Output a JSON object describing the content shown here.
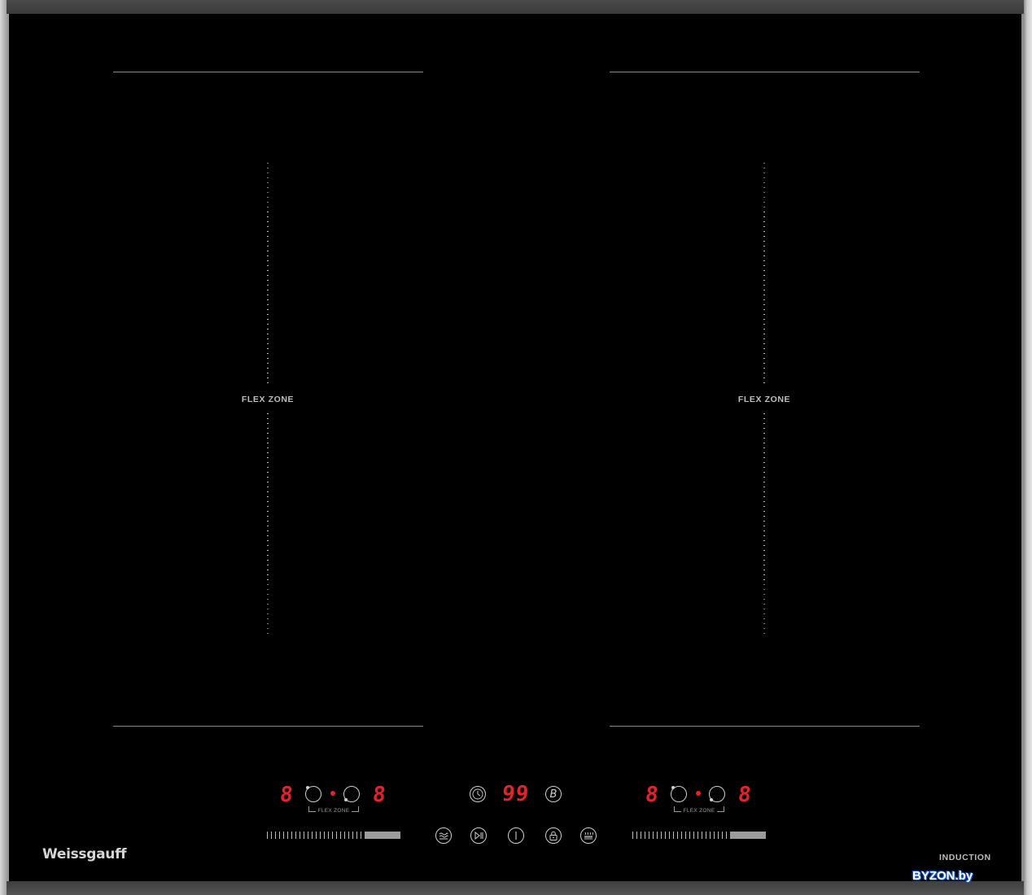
{
  "zones": {
    "left": {
      "label": "FLEX ZONE",
      "display_left": "8",
      "display_right": "8",
      "link_label": "FLEX ZONE"
    },
    "right": {
      "label": "FLEX ZONE",
      "display_left": "8",
      "display_right": "8",
      "link_label": "FLEX ZONE"
    }
  },
  "center": {
    "timer_display": "99",
    "icons": {
      "timer": "clock-icon",
      "boost": "boost-b-icon",
      "keep_warm": "keep-warm-icon",
      "pause": "play-pause-icon",
      "power": "power-icon",
      "lock": "lock-icon",
      "bbq": "bbq-icon"
    }
  },
  "branding": {
    "brand": "Weissgauff",
    "type_label": "INDUCTION",
    "watermark": "BYZON.by"
  },
  "colors": {
    "glass": "#000000",
    "display": "#e0242b",
    "frame": "#9a9a9a"
  }
}
